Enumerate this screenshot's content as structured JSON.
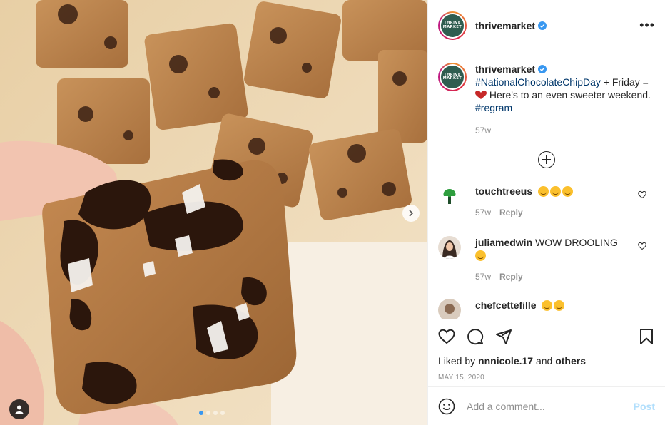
{
  "post": {
    "author": "thrivemarket",
    "avatar_label_line1": "THRIVE",
    "avatar_label_line2": "MARKET",
    "more_label": "•••"
  },
  "caption": {
    "author": "thrivemarket",
    "hashtag1": "#NationalChocolateChipDay",
    "text1": " + Friday = ",
    "text2": " Here's to an even sweeter weekend. ",
    "hashtag2": "#regram",
    "age": "57w"
  },
  "comments": [
    {
      "user": "touchtreeus",
      "text": "",
      "age": "57w",
      "reply": "Reply"
    },
    {
      "user": "juliamedwin",
      "text": "WOW DROOLING",
      "age": "57w",
      "reply": "Reply"
    },
    {
      "user": "chefcettefille",
      "text": "",
      "age": "",
      "reply": ""
    }
  ],
  "footer": {
    "liked_by_prefix": "Liked by ",
    "liked_by_user": "nnnicole.17",
    "liked_by_mid": " and ",
    "liked_by_others": "others",
    "date": "MAY 15, 2020"
  },
  "add_comment": {
    "placeholder": "Add a comment...",
    "post_label": "Post"
  },
  "colors": {
    "link": "#00376b",
    "verified": "#3897f0",
    "post_disabled": "#b2dffc"
  }
}
